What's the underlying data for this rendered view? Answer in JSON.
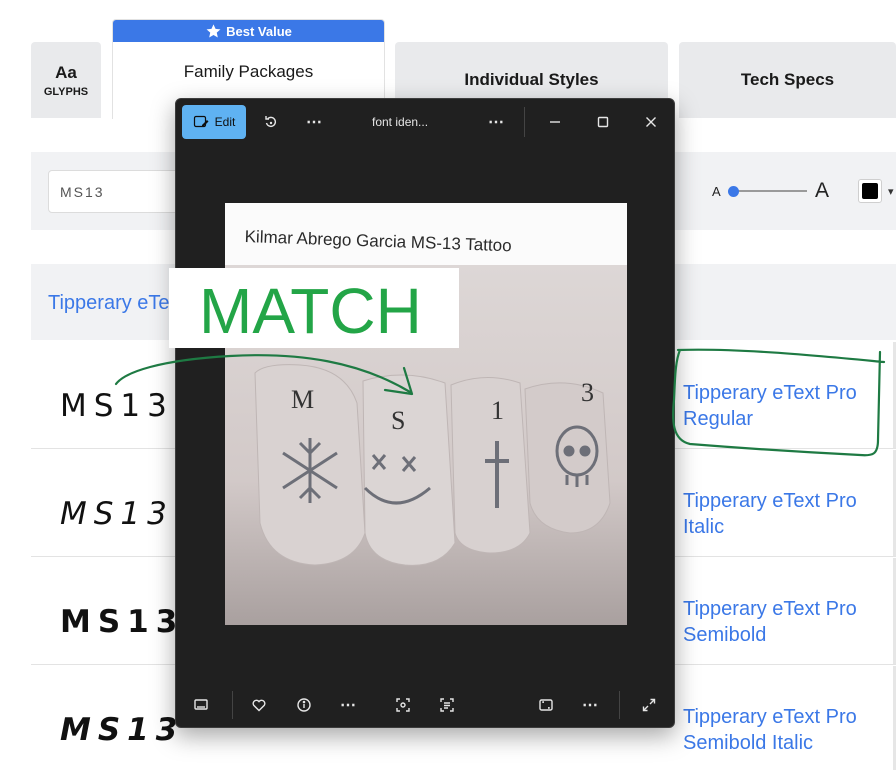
{
  "tabs": {
    "glyphs_aa": "Aa",
    "glyphs_label": "GLYPHS",
    "best_value_badge": "Best Value",
    "family_packages": "Family Packages",
    "individual_styles": "Individual Styles",
    "tech_specs": "Tech Specs"
  },
  "controls": {
    "sample_text_value": "MS13",
    "size_small_label": "A",
    "size_large_label": "A",
    "size_slider_level": 0.05,
    "text_color": "#000000"
  },
  "family": {
    "name": "Tipperary eText Pro"
  },
  "styles": [
    {
      "sample": "MS13",
      "name_line1": "Tipperary eText Pro",
      "name_line2": "Regular"
    },
    {
      "sample": "MS13",
      "name_line1": "Tipperary eText Pro",
      "name_line2": "Italic"
    },
    {
      "sample": "MS13",
      "name_line1": "Tipperary eText Pro",
      "name_line2": "Semibold"
    },
    {
      "sample": "MS13",
      "name_line1": "Tipperary eText Pro",
      "name_line2": "Semibold Italic"
    }
  ],
  "viewer": {
    "edit_label": "Edit",
    "title": "font iden...",
    "photo": {
      "caption": "Kilmar Abrego Garcia MS-13 Tattoo",
      "finger_letters": [
        "M",
        "S",
        "1",
        "3"
      ]
    }
  },
  "annotation": {
    "match_text": "MATCH",
    "color": "#1e7a43"
  },
  "colors": {
    "accent_blue": "#3b78e7",
    "match_green": "#23a547",
    "viewer_bg": "#202020",
    "edit_button": "#5fb2f2"
  }
}
